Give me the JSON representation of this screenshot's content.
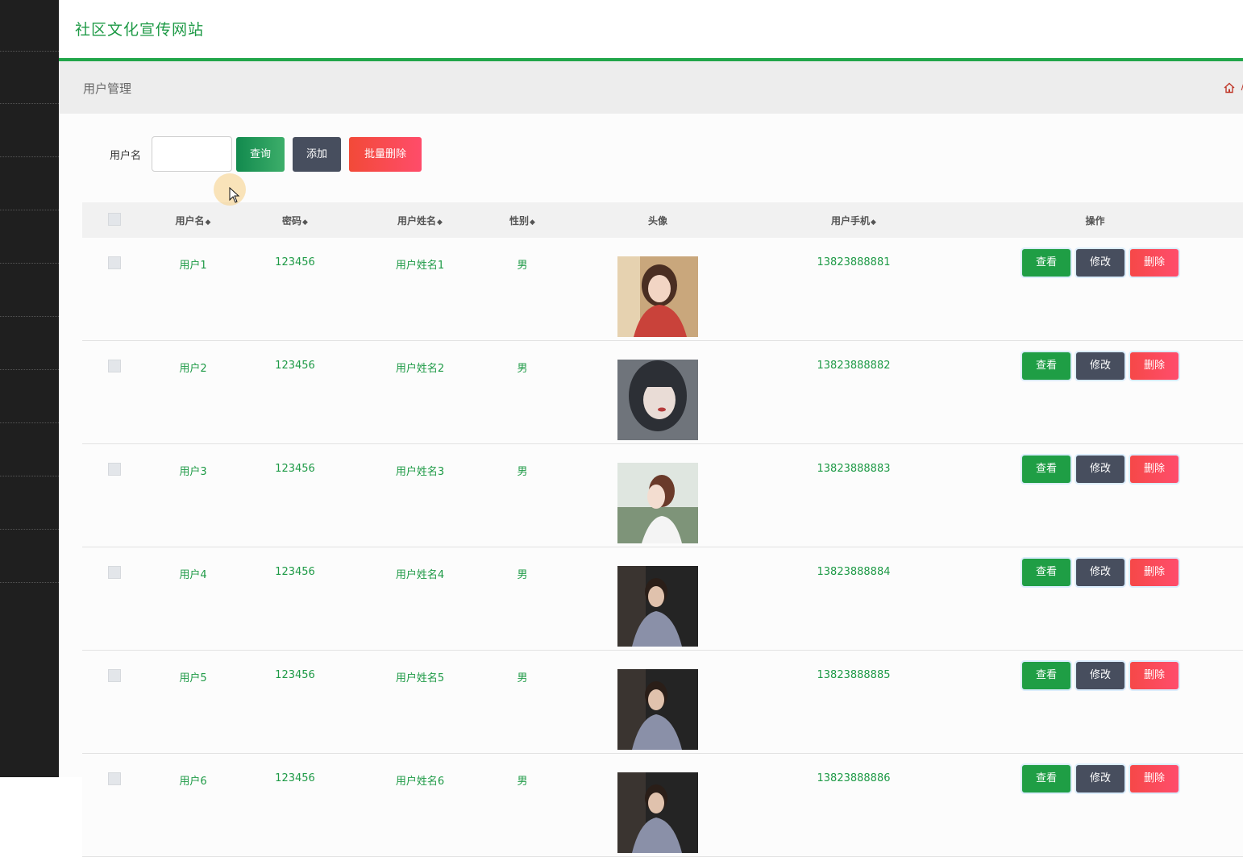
{
  "header": {
    "site_title": "社区文化宣传网站"
  },
  "breadcrumb": {
    "title": "用户管理",
    "separator": "/"
  },
  "search": {
    "label": "用户名",
    "value": "",
    "query_label": "查询",
    "add_label": "添加",
    "batch_delete_label": "批量删除"
  },
  "table": {
    "columns": [
      "用户名",
      "密码",
      "用户姓名",
      "性别",
      "头像",
      "用户手机",
      "操作"
    ],
    "rows": [
      {
        "username": "用户1",
        "password": "123456",
        "name": "用户姓名1",
        "gender": "男",
        "phone": "13823888881"
      },
      {
        "username": "用户2",
        "password": "123456",
        "name": "用户姓名2",
        "gender": "男",
        "phone": "13823888882"
      },
      {
        "username": "用户3",
        "password": "123456",
        "name": "用户姓名3",
        "gender": "男",
        "phone": "13823888883"
      },
      {
        "username": "用户4",
        "password": "123456",
        "name": "用户姓名4",
        "gender": "男",
        "phone": "13823888884"
      },
      {
        "username": "用户5",
        "password": "123456",
        "name": "用户姓名5",
        "gender": "男",
        "phone": "13823888885"
      },
      {
        "username": "用户6",
        "password": "123456",
        "name": "用户姓名6",
        "gender": "男",
        "phone": "13823888886"
      }
    ],
    "actions": {
      "view": "查看",
      "edit": "修改",
      "delete": "删除"
    }
  },
  "colors": {
    "accent": "#22a64a",
    "danger": "#f64848",
    "dark": "#474e5e",
    "sidebar": "#1f1f1f"
  },
  "icons": {
    "home": "home-icon",
    "sort": "sort-icon",
    "cursor": "cursor-icon"
  }
}
